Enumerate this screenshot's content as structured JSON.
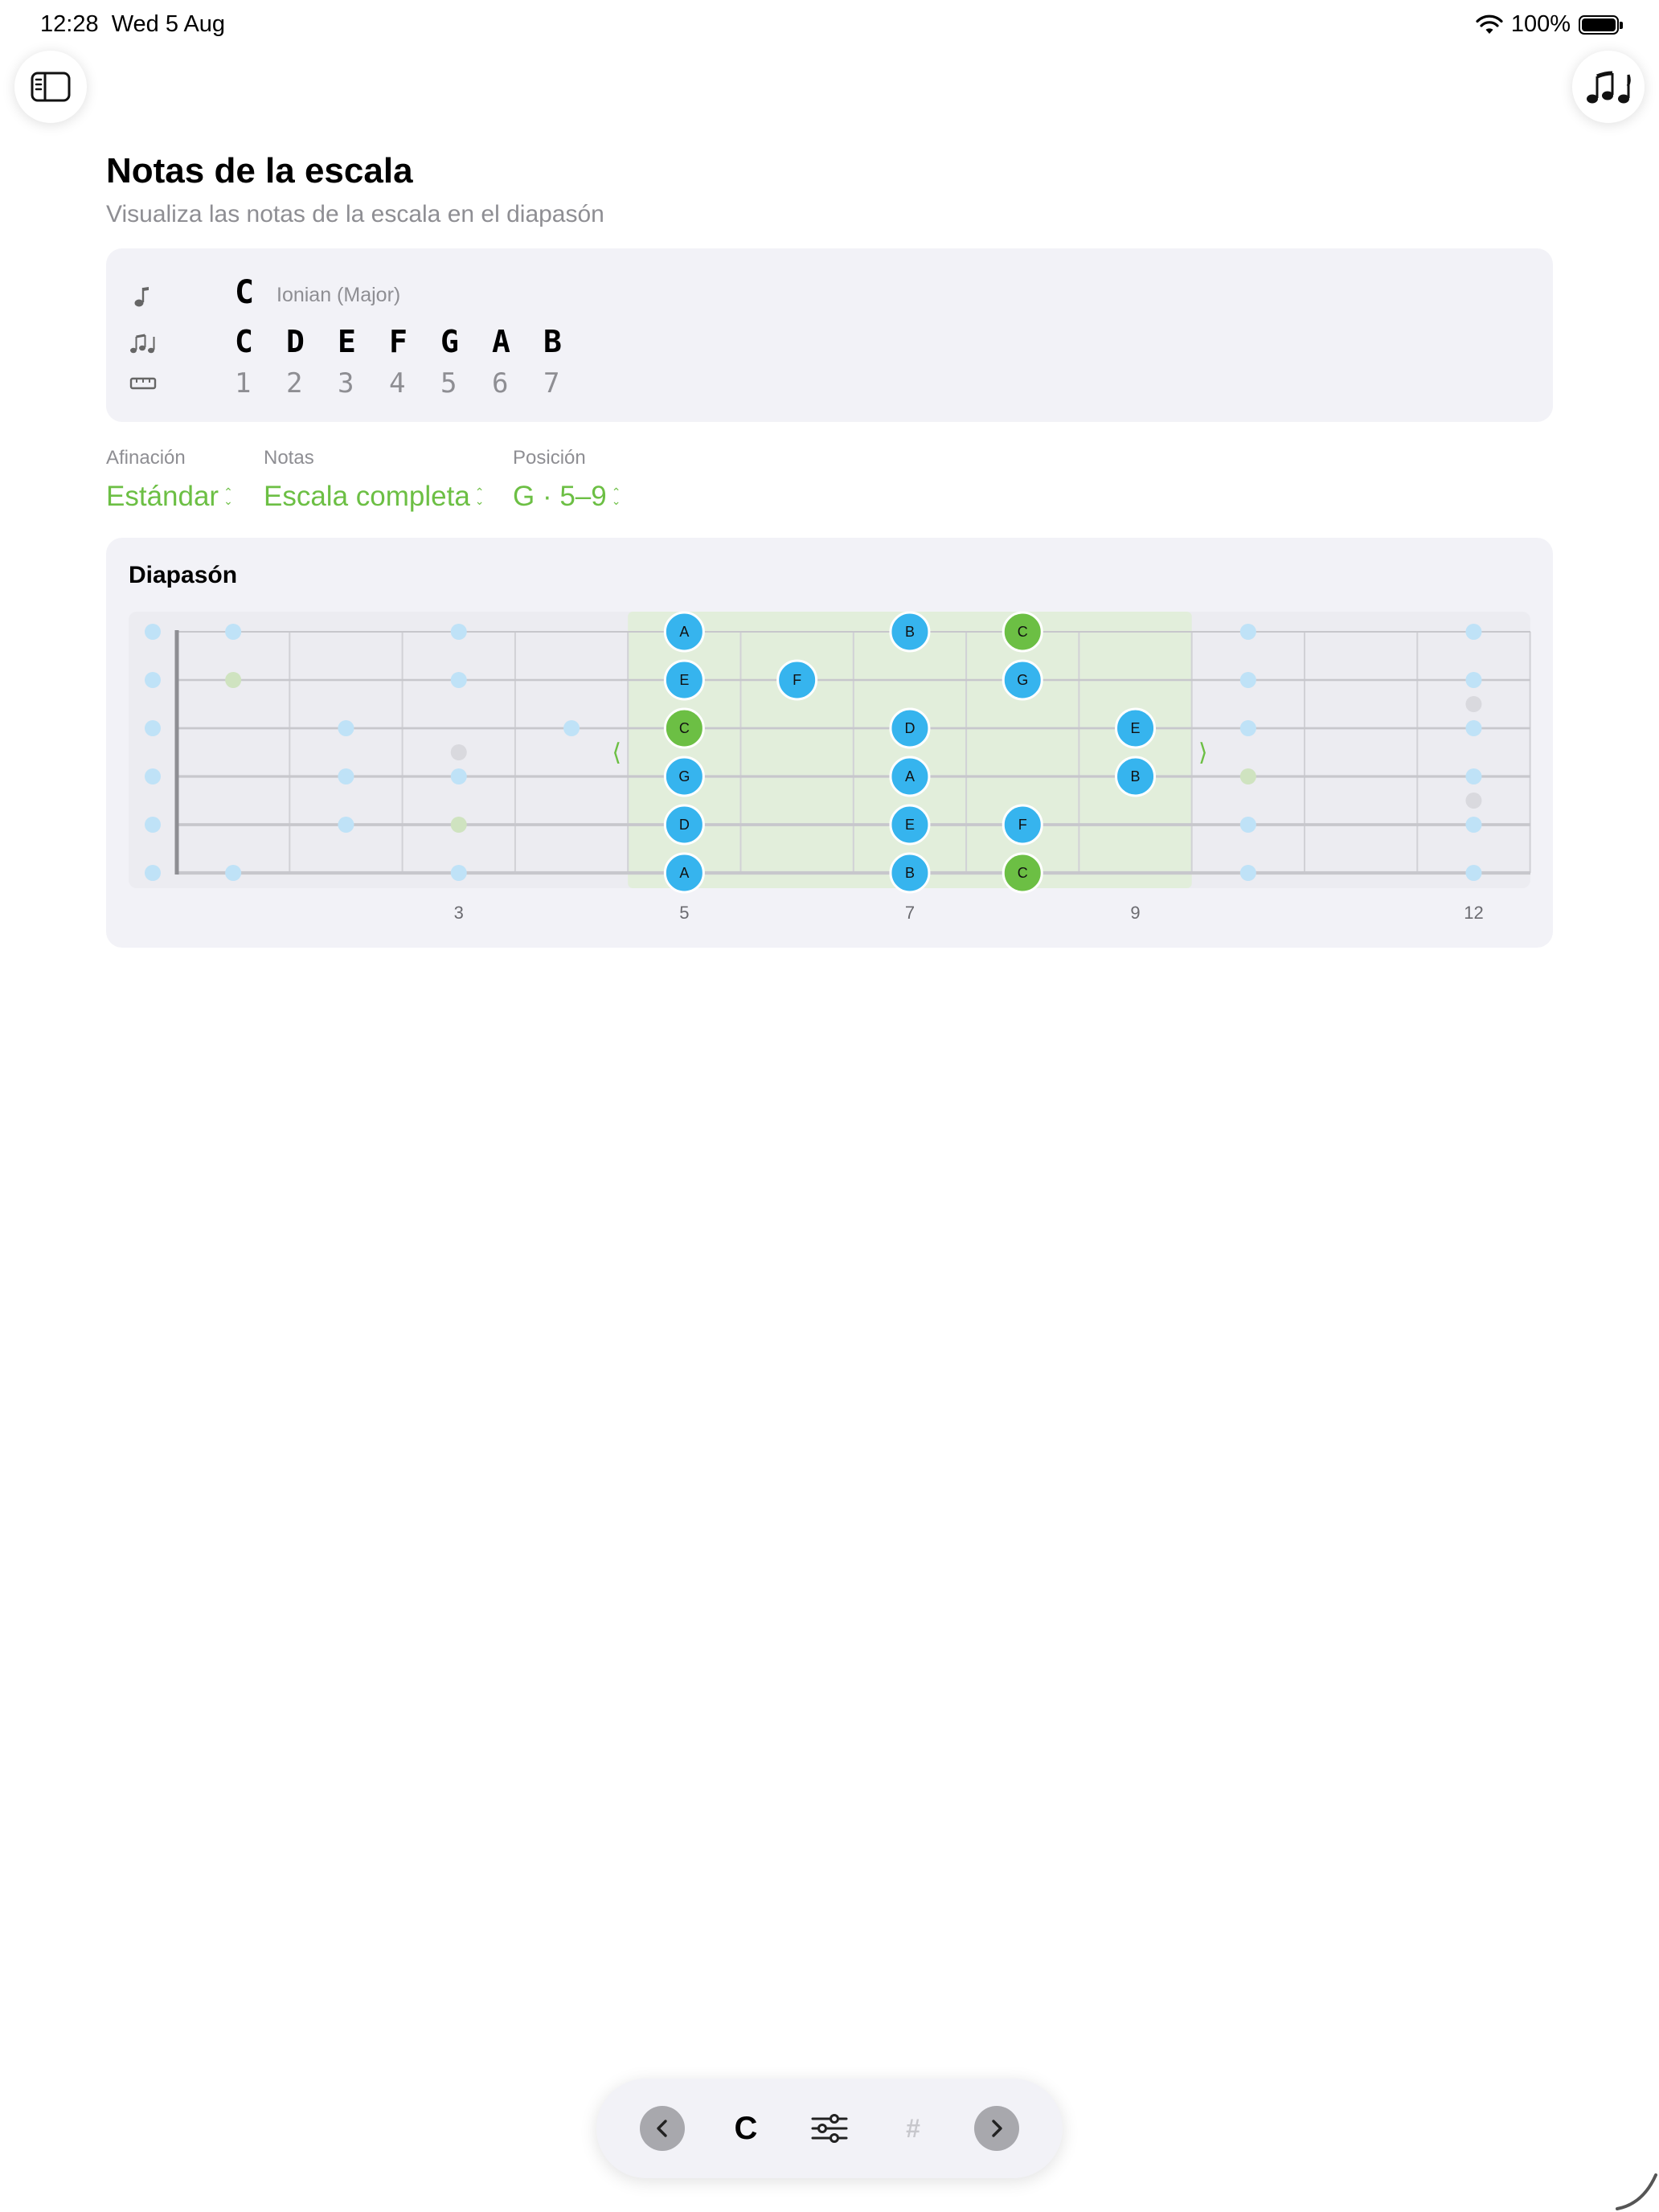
{
  "status_bar": {
    "time": "12:28",
    "date": "Wed 5 Aug",
    "battery": "100%",
    "battery_level": 1.0
  },
  "top_buttons": {
    "left_icon": "sidebar-icon",
    "right_icon": "music-notes-icon"
  },
  "header": {
    "title": "Notas de la escala",
    "subtitle": "Visualiza las notas de la escala en el diapasón"
  },
  "scale_info": {
    "root": "C",
    "mode": "Ionian (Major)",
    "notes": [
      "C",
      "D",
      "E",
      "F",
      "G",
      "A",
      "B"
    ],
    "degrees": [
      "1",
      "2",
      "3",
      "4",
      "5",
      "6",
      "7"
    ],
    "icons": [
      "note-icon",
      "notes-icon",
      "ruler-icon"
    ]
  },
  "pickers": [
    {
      "label": "Afinación",
      "value": "Estándar"
    },
    {
      "label": "Notas",
      "value": "Escala completa"
    },
    {
      "label": "Posición",
      "value": "G · 5–9"
    }
  ],
  "fretboard": {
    "title": "Diapasón",
    "colors": {
      "accent": "#6cbf44",
      "note": "#36b4ee",
      "root": "#6cbf44",
      "highlight": "#e2eedb"
    },
    "fret_count": 12,
    "position_range": [
      5,
      9
    ],
    "fret_labels": [
      {
        "fret": 3,
        "label": "3"
      },
      {
        "fret": 5,
        "label": "5"
      },
      {
        "fret": 7,
        "label": "7"
      },
      {
        "fret": 9,
        "label": "9"
      },
      {
        "fret": 12,
        "label": "12"
      }
    ],
    "inlays": [
      {
        "fret": 3,
        "between": [
          3,
          4
        ]
      },
      {
        "fret": 12,
        "between": [
          2,
          3
        ]
      },
      {
        "fret": 12,
        "between": [
          4,
          5
        ]
      }
    ],
    "range_markers": {
      "left": "⟨",
      "right": "⟩"
    },
    "active_notes": [
      {
        "string": 1,
        "fret": 5,
        "note": "A",
        "root": false
      },
      {
        "string": 1,
        "fret": 7,
        "note": "B",
        "root": false
      },
      {
        "string": 1,
        "fret": 8,
        "note": "C",
        "root": true
      },
      {
        "string": 2,
        "fret": 5,
        "note": "E",
        "root": false
      },
      {
        "string": 2,
        "fret": 6,
        "note": "F",
        "root": false
      },
      {
        "string": 2,
        "fret": 8,
        "note": "G",
        "root": false
      },
      {
        "string": 3,
        "fret": 5,
        "note": "C",
        "root": true
      },
      {
        "string": 3,
        "fret": 7,
        "note": "D",
        "root": false
      },
      {
        "string": 3,
        "fret": 9,
        "note": "E",
        "root": false
      },
      {
        "string": 4,
        "fret": 5,
        "note": "G",
        "root": false
      },
      {
        "string": 4,
        "fret": 7,
        "note": "A",
        "root": false
      },
      {
        "string": 4,
        "fret": 9,
        "note": "B",
        "root": false
      },
      {
        "string": 5,
        "fret": 5,
        "note": "D",
        "root": false
      },
      {
        "string": 5,
        "fret": 7,
        "note": "E",
        "root": false
      },
      {
        "string": 5,
        "fret": 8,
        "note": "F",
        "root": false
      },
      {
        "string": 6,
        "fret": 5,
        "note": "A",
        "root": false
      },
      {
        "string": 6,
        "fret": 7,
        "note": "B",
        "root": false
      },
      {
        "string": 6,
        "fret": 8,
        "note": "C",
        "root": true
      }
    ],
    "ghost_notes": [
      {
        "string": 1,
        "fret": 0,
        "root": false
      },
      {
        "string": 1,
        "fret": 1,
        "root": false
      },
      {
        "string": 1,
        "fret": 3,
        "root": false
      },
      {
        "string": 1,
        "fret": 10,
        "root": false
      },
      {
        "string": 1,
        "fret": 12,
        "root": false
      },
      {
        "string": 2,
        "fret": 0,
        "root": false
      },
      {
        "string": 2,
        "fret": 1,
        "root": true
      },
      {
        "string": 2,
        "fret": 3,
        "root": false
      },
      {
        "string": 2,
        "fret": 10,
        "root": false
      },
      {
        "string": 2,
        "fret": 12,
        "root": false
      },
      {
        "string": 3,
        "fret": 0,
        "root": false
      },
      {
        "string": 3,
        "fret": 2,
        "root": false
      },
      {
        "string": 3,
        "fret": 4,
        "root": false
      },
      {
        "string": 3,
        "fret": 10,
        "root": false
      },
      {
        "string": 3,
        "fret": 12,
        "root": false
      },
      {
        "string": 4,
        "fret": 0,
        "root": false
      },
      {
        "string": 4,
        "fret": 2,
        "root": false
      },
      {
        "string": 4,
        "fret": 3,
        "root": false
      },
      {
        "string": 4,
        "fret": 10,
        "root": true
      },
      {
        "string": 4,
        "fret": 12,
        "root": false
      },
      {
        "string": 5,
        "fret": 0,
        "root": false
      },
      {
        "string": 5,
        "fret": 2,
        "root": false
      },
      {
        "string": 5,
        "fret": 3,
        "root": true
      },
      {
        "string": 5,
        "fret": 10,
        "root": false
      },
      {
        "string": 5,
        "fret": 12,
        "root": false
      },
      {
        "string": 6,
        "fret": 0,
        "root": false
      },
      {
        "string": 6,
        "fret": 1,
        "root": false
      },
      {
        "string": 6,
        "fret": 3,
        "root": false
      },
      {
        "string": 6,
        "fret": 10,
        "root": false
      },
      {
        "string": 6,
        "fret": 12,
        "root": false
      }
    ]
  },
  "toolbar": {
    "prev_icon": "chevron-left-icon",
    "key": "C",
    "settings_icon": "sliders-icon",
    "sharp": "#",
    "next_icon": "chevron-right-icon"
  }
}
